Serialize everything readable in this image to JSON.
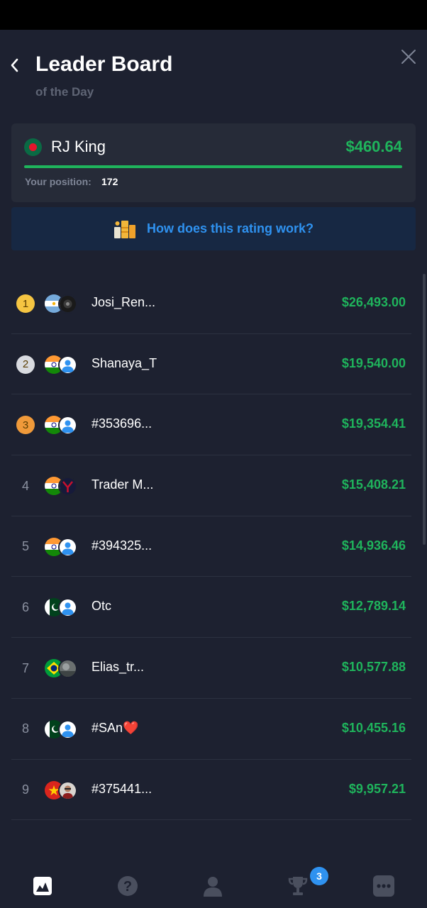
{
  "header": {
    "title": "Leader Board",
    "subtitle": "of the Day"
  },
  "me": {
    "name": "RJ King",
    "amount": "$460.64",
    "position_label": "Your position:",
    "position_value": "172",
    "progress": 1.0,
    "flag": "bangladesh"
  },
  "rating_link": {
    "label": "How does this rating work?",
    "icon": "trophy-stack-icon"
  },
  "leaders": [
    {
      "rank": "1",
      "name": "Josi_Ren...",
      "amount": "$26,493.00",
      "flag": "argentina",
      "avatar": "dark-photo"
    },
    {
      "rank": "2",
      "name": "Shanaya_T",
      "amount": "$19,540.00",
      "flag": "india",
      "avatar": "default-user"
    },
    {
      "rank": "3",
      "name": "#353696...",
      "amount": "$19,354.41",
      "flag": "india",
      "avatar": "default-user"
    },
    {
      "rank": "4",
      "name": "Trader M...",
      "amount": "$15,408.21",
      "flag": "india",
      "avatar": "spider-photo"
    },
    {
      "rank": "5",
      "name": "#394325...",
      "amount": "$14,936.46",
      "flag": "india",
      "avatar": "default-user"
    },
    {
      "rank": "6",
      "name": "Otc",
      "amount": "$12,789.14",
      "flag": "pakistan",
      "avatar": "default-user"
    },
    {
      "rank": "7",
      "name": "Elias_tr...",
      "amount": "$10,577.88",
      "flag": "brazil",
      "avatar": "grey-photo"
    },
    {
      "rank": "8",
      "name": "#SAn❤️",
      "amount": "$10,455.16",
      "flag": "pakistan",
      "avatar": "default-user"
    },
    {
      "rank": "9",
      "name": "#375441...",
      "amount": "$9,957.21",
      "flag": "vietnam",
      "avatar": "man-photo"
    }
  ],
  "nav": {
    "items": [
      "chart-icon",
      "help-icon",
      "profile-icon",
      "trophy-icon",
      "more-icon"
    ],
    "trophy_badge": "3"
  },
  "colors": {
    "background": "#1d2130",
    "card": "#262b38",
    "accent_green": "#1fb45c",
    "accent_blue": "#2f92f0",
    "gold": "#f5c542",
    "silver": "#d9dbe0",
    "bronze": "#f09a3a"
  }
}
